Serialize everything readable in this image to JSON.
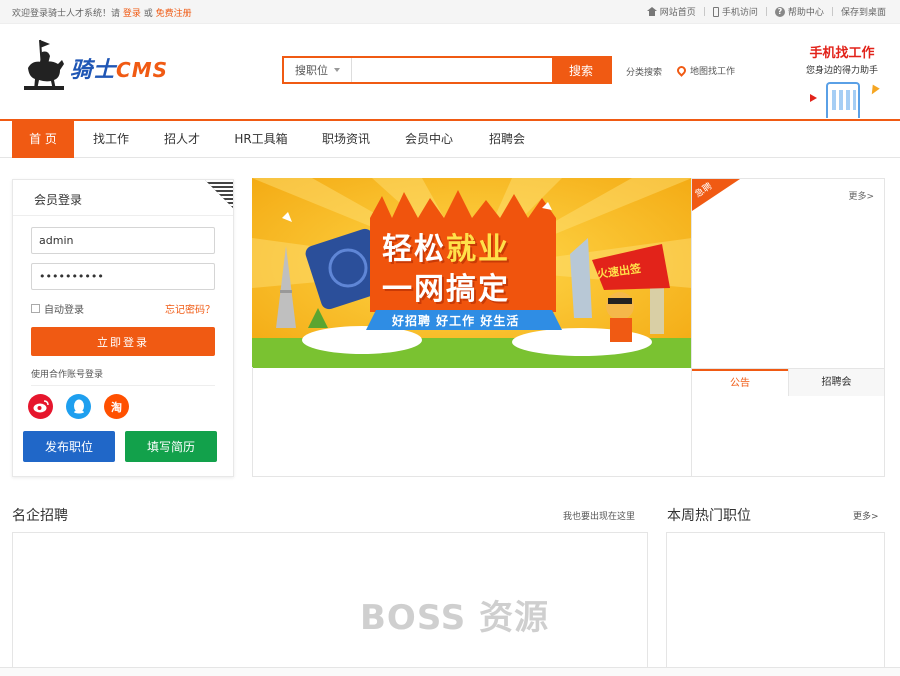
{
  "topbar": {
    "welcome": "欢迎登录骑士人才系统！请",
    "login": "登录",
    "or": "或",
    "register": "免费注册",
    "links": [
      "网站首页",
      "手机访问",
      "帮助中心",
      "保存到桌面"
    ]
  },
  "header": {
    "logo_main": "骑士",
    "logo_cms": "CMS",
    "search_type": "搜职位",
    "search_placeholder": "",
    "search_button": "搜索",
    "category_search": "分类搜索",
    "map_search": "地图找工作",
    "mobile_title": "手机找工作",
    "mobile_subtitle": "您身边的得力助手"
  },
  "nav": {
    "items": [
      "首 页",
      "找工作",
      "招人才",
      "HR工具箱",
      "职场资讯",
      "会员中心",
      "招聘会"
    ]
  },
  "login": {
    "title": "会员登录",
    "username": "admin",
    "password": "••••••••••",
    "remember": "自动登录",
    "forgot": "忘记密码？",
    "submit": "立即登录",
    "partner": "使用合作账号登录",
    "social": [
      "微博",
      "QQ",
      "淘"
    ],
    "publish": "发布职位",
    "resume": "填写简历"
  },
  "banner": {
    "line1a": "轻松",
    "line1b": "就业",
    "line2": "一网搞定",
    "line3": "好招聘  好工作  好生活",
    "flag": "火速出签"
  },
  "rightbox": {
    "badge": "急聘",
    "more": "更多>",
    "tab_notice": "公告",
    "tab_fair": "招聘会"
  },
  "sections": {
    "famous_title": "名企招聘",
    "famous_link": "我也要出现在这里",
    "hot_title": "本周热门职位",
    "hot_link": "更多>"
  },
  "watermark": "BOSS 资源",
  "colors": {
    "accent": "#f05a13",
    "blue_button": "#2067c8",
    "green_button": "#12a14b"
  }
}
